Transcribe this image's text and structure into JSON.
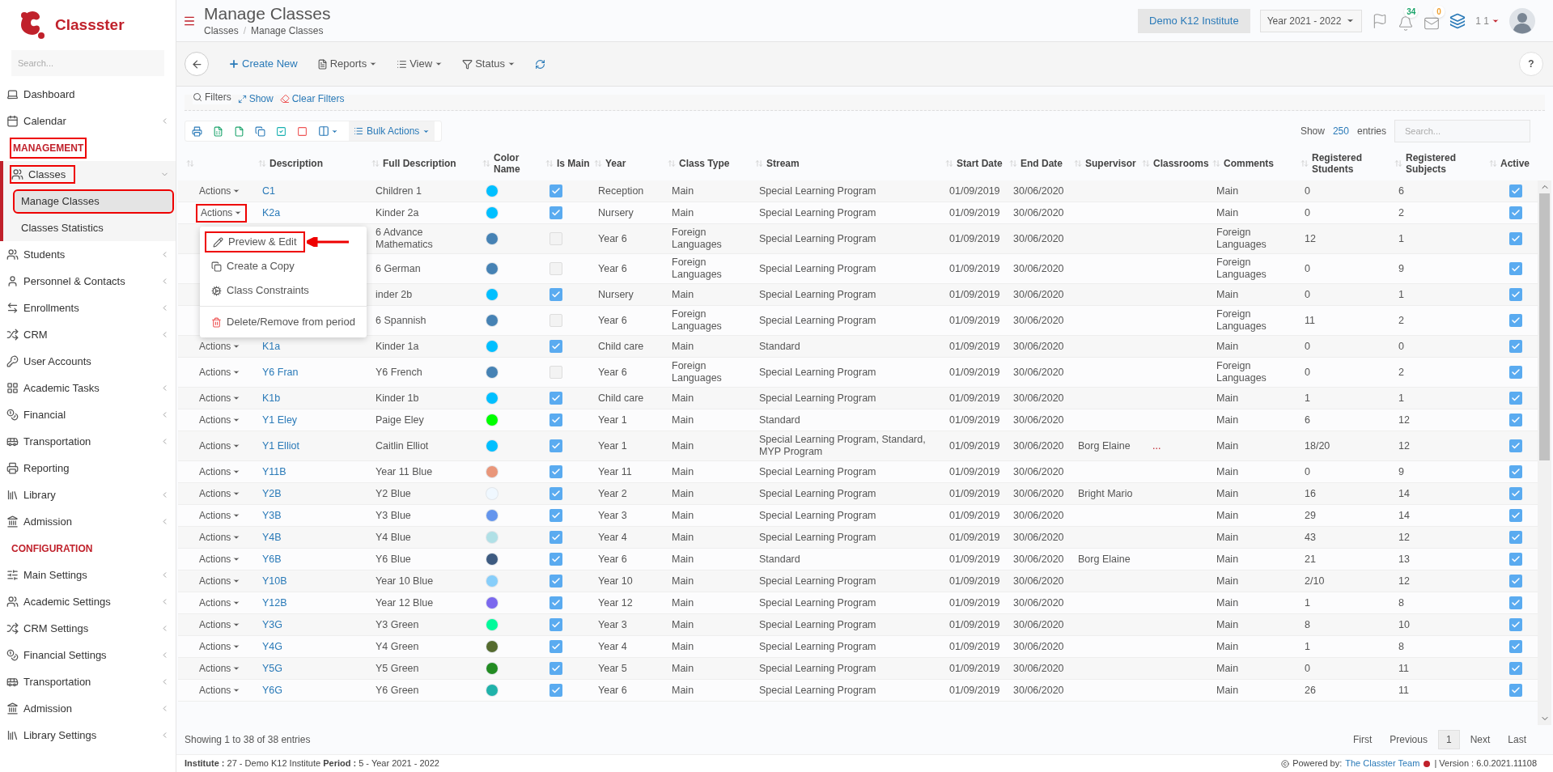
{
  "sidebar": {
    "logo": "Classster",
    "search_placeholder": "Search...",
    "items": [
      {
        "kind": "item",
        "label": "Dashboard",
        "has_submenu": false,
        "expanded": false,
        "highlighted": false
      },
      {
        "kind": "item",
        "label": "Calendar",
        "has_submenu": true,
        "expanded": false,
        "highlighted": false
      },
      {
        "kind": "section",
        "label": "MANAGEMENT",
        "highlighted": true
      },
      {
        "kind": "item",
        "label": "Classes",
        "has_submenu": true,
        "expanded": true,
        "highlighted": true,
        "children": [
          {
            "label": "Manage Classes",
            "selected": true,
            "highlighted": true
          },
          {
            "label": "Classes Statistics",
            "selected": false,
            "highlighted": false
          }
        ]
      },
      {
        "kind": "item",
        "label": "Students",
        "has_submenu": true,
        "expanded": false,
        "highlighted": false
      },
      {
        "kind": "item",
        "label": "Personnel & Contacts",
        "has_submenu": true,
        "expanded": false,
        "highlighted": false
      },
      {
        "kind": "item",
        "label": "Enrollments",
        "has_submenu": true,
        "expanded": false,
        "highlighted": false
      },
      {
        "kind": "item",
        "label": "CRM",
        "has_submenu": true,
        "expanded": false,
        "highlighted": false
      },
      {
        "kind": "item",
        "label": "User Accounts",
        "has_submenu": false,
        "expanded": false,
        "highlighted": false
      },
      {
        "kind": "item",
        "label": "Academic Tasks",
        "has_submenu": true,
        "expanded": false,
        "highlighted": false
      },
      {
        "kind": "item",
        "label": "Financial",
        "has_submenu": true,
        "expanded": false,
        "highlighted": false
      },
      {
        "kind": "item",
        "label": "Transportation",
        "has_submenu": true,
        "expanded": false,
        "highlighted": false
      },
      {
        "kind": "item",
        "label": "Reporting",
        "has_submenu": false,
        "expanded": false,
        "highlighted": false
      },
      {
        "kind": "item",
        "label": "Library",
        "has_submenu": true,
        "expanded": false,
        "highlighted": false
      },
      {
        "kind": "item",
        "label": "Admission",
        "has_submenu": true,
        "expanded": false,
        "highlighted": false
      },
      {
        "kind": "section",
        "label": "CONFIGURATION",
        "highlighted": false
      },
      {
        "kind": "item",
        "label": "Main Settings",
        "has_submenu": true,
        "expanded": false,
        "highlighted": false
      },
      {
        "kind": "item",
        "label": "Academic Settings",
        "has_submenu": true,
        "expanded": false,
        "highlighted": false
      },
      {
        "kind": "item",
        "label": "CRM Settings",
        "has_submenu": true,
        "expanded": false,
        "highlighted": false
      },
      {
        "kind": "item",
        "label": "Financial Settings",
        "has_submenu": true,
        "expanded": false,
        "highlighted": false
      },
      {
        "kind": "item",
        "label": "Transportation",
        "has_submenu": true,
        "expanded": false,
        "highlighted": false
      },
      {
        "kind": "item",
        "label": "Admission",
        "has_submenu": true,
        "expanded": false,
        "highlighted": false
      },
      {
        "kind": "item",
        "label": "Library Settings",
        "has_submenu": true,
        "expanded": false,
        "highlighted": false
      }
    ]
  },
  "header": {
    "title": "Manage Classes",
    "breadcrumb": [
      "Classes",
      "Manage Classes"
    ],
    "breadcrumb_separator": "/",
    "institute": "Demo K12 Institute",
    "year": "Year 2021 - 2022",
    "notifications": "34",
    "messages": "0",
    "user": "1 1"
  },
  "toolbar": {
    "buttons": [
      {
        "label": "Create New",
        "kind": "create"
      },
      {
        "label": "Reports",
        "kind": "reports"
      },
      {
        "label": "View",
        "kind": "view"
      },
      {
        "label": "Status",
        "kind": "status"
      }
    ],
    "help": "?"
  },
  "filters": {
    "legend": "Filters",
    "show": "Show",
    "clear": "Clear Filters"
  },
  "table_tools": {
    "bulk": "Bulk Actions",
    "show_label": "Show",
    "entries": "250",
    "entries_label": "entries",
    "search_placeholder": "Search..."
  },
  "table": {
    "columns": [
      "Description",
      "Full Description",
      "Color Name",
      "Is Main",
      "Year",
      "Class Type",
      "Stream",
      "Start Date",
      "End Date",
      "Supervisor",
      "Classrooms",
      "Comments",
      "Registered Students",
      "Registered Subjects",
      "Active"
    ],
    "rows": [
      {
        "actions": "Actions",
        "description": "C1",
        "full_description": "Children 1",
        "color": "#00bfff",
        "is_main": true,
        "year": "Reception",
        "class_type": "Main",
        "stream": "Special Learning Program",
        "start": "01/09/2019",
        "end": "30/06/2020",
        "comments": "Main",
        "students": "0",
        "subjects": "6",
        "active": true
      },
      {
        "actions": "Actions",
        "description": "K2a",
        "full_description": "Kinder 2a",
        "color": "#00bfff",
        "is_main": true,
        "year": "Nursery",
        "class_type": "Main",
        "stream": "Special Learning Program",
        "start": "01/09/2019",
        "end": "30/06/2020",
        "comments": "Main",
        "students": "0",
        "subjects": "2",
        "active": true,
        "highlighted": true,
        "menu": [
          {
            "label": "Preview & Edit",
            "kind": "edit",
            "highlighted": true
          },
          {
            "label": "Create a Copy",
            "kind": "copy",
            "highlighted": false
          },
          {
            "label": "Class Constraints",
            "kind": "constraints",
            "highlighted": false
          },
          {
            "label": "Delete/Remove from period",
            "kind": "delete",
            "highlighted": false
          }
        ]
      },
      {
        "full_description": "6 Advance Mathematics",
        "color": "#4682b4",
        "is_main": false,
        "year": "Year 6",
        "class_type": "Foreign Languages",
        "stream": "Special Learning Program",
        "start": "01/09/2019",
        "end": "30/06/2020",
        "comments": "Foreign Languages",
        "students": "12",
        "subjects": "1",
        "active": true
      },
      {
        "full_description": "6 German",
        "color": "#4682b4",
        "is_main": false,
        "year": "Year 6",
        "class_type": "Foreign Languages",
        "stream": "Special Learning Program",
        "start": "01/09/2019",
        "end": "30/06/2020",
        "comments": "Foreign Languages",
        "students": "0",
        "subjects": "9",
        "active": true
      },
      {
        "full_description": "inder 2b",
        "color": "#00bfff",
        "is_main": true,
        "year": "Nursery",
        "class_type": "Main",
        "stream": "Special Learning Program",
        "start": "01/09/2019",
        "end": "30/06/2020",
        "comments": "Main",
        "students": "0",
        "subjects": "1",
        "active": true
      },
      {
        "full_description": "6 Spannish",
        "color": "#4682b4",
        "is_main": false,
        "year": "Year 6",
        "class_type": "Foreign Languages",
        "stream": "Special Learning Program",
        "start": "01/09/2019",
        "end": "30/06/2020",
        "comments": "Foreign Languages",
        "students": "11",
        "subjects": "2",
        "active": true
      },
      {
        "actions": "Actions",
        "description": "K1a",
        "full_description": "Kinder 1a",
        "color": "#00bfff",
        "is_main": true,
        "year": "Child care",
        "class_type": "Main",
        "stream": "Standard",
        "start": "01/09/2019",
        "end": "30/06/2020",
        "comments": "Main",
        "students": "0",
        "subjects": "0",
        "active": true
      },
      {
        "actions": "Actions",
        "description": "Y6 Fran",
        "full_description": "Y6 French",
        "color": "#4682b4",
        "is_main": false,
        "year": "Year 6",
        "class_type": "Foreign Languages",
        "stream": "Special Learning Program",
        "start": "01/09/2019",
        "end": "30/06/2020",
        "comments": "Foreign Languages",
        "students": "0",
        "subjects": "2",
        "active": true
      },
      {
        "actions": "Actions",
        "description": "K1b",
        "full_description": "Kinder 1b",
        "color": "#00bfff",
        "is_main": true,
        "year": "Child care",
        "class_type": "Main",
        "stream": "Special Learning Program",
        "start": "01/09/2019",
        "end": "30/06/2020",
        "comments": "Main",
        "students": "1",
        "subjects": "1",
        "active": true
      },
      {
        "actions": "Actions",
        "description": "Y1 Eley",
        "full_description": "Paige Eley",
        "color": "#00ff00",
        "is_main": true,
        "year": "Year 1",
        "class_type": "Main",
        "stream": "Standard",
        "start": "01/09/2019",
        "end": "30/06/2020",
        "comments": "Main",
        "students": "6",
        "subjects": "12",
        "active": true
      },
      {
        "actions": "Actions",
        "description": "Y1 Elliot",
        "full_description": "Caitlin Elliot",
        "color": "#00bfff",
        "is_main": true,
        "year": "Year 1",
        "class_type": "Main",
        "stream": "Special Learning Program, Standard, MYP Program",
        "start": "01/09/2019",
        "end": "30/06/2020",
        "supervisor": "Borg Elaine",
        "classrooms": "...",
        "comments": "Main",
        "students": "18/20",
        "subjects": "12",
        "active": true
      },
      {
        "actions": "Actions",
        "description": "Y11B",
        "full_description": "Year 11 Blue",
        "color": "#e9967a",
        "is_main": true,
        "year": "Year 11",
        "class_type": "Main",
        "stream": "Special Learning Program",
        "start": "01/09/2019",
        "end": "30/06/2020",
        "comments": "Main",
        "students": "0",
        "subjects": "9",
        "active": true
      },
      {
        "actions": "Actions",
        "description": "Y2B",
        "full_description": "Y2 Blue",
        "color": "#f0f8ff",
        "is_main": true,
        "year": "Year 2",
        "class_type": "Main",
        "stream": "Special Learning Program",
        "start": "01/09/2019",
        "end": "30/06/2020",
        "supervisor": "Bright Mario",
        "comments": "Main",
        "students": "16",
        "subjects": "14",
        "active": true
      },
      {
        "actions": "Actions",
        "description": "Y3B",
        "full_description": "Y3 Blue",
        "color": "#6495ed",
        "is_main": true,
        "year": "Year 3",
        "class_type": "Main",
        "stream": "Special Learning Program",
        "start": "01/09/2019",
        "end": "30/06/2020",
        "comments": "Main",
        "students": "29",
        "subjects": "14",
        "active": true
      },
      {
        "actions": "Actions",
        "description": "Y4B",
        "full_description": "Y4 Blue",
        "color": "#b0e0e6",
        "is_main": true,
        "year": "Year 4",
        "class_type": "Main",
        "stream": "Special Learning Program",
        "start": "01/09/2019",
        "end": "30/06/2020",
        "comments": "Main",
        "students": "43",
        "subjects": "12",
        "active": true
      },
      {
        "actions": "Actions",
        "description": "Y6B",
        "full_description": "Y6 Blue",
        "color": "#3d5a80",
        "is_main": true,
        "year": "Year 6",
        "class_type": "Main",
        "stream": "Standard",
        "start": "01/09/2019",
        "end": "30/06/2020",
        "supervisor": "Borg Elaine",
        "comments": "Main",
        "students": "21",
        "subjects": "13",
        "active": true
      },
      {
        "actions": "Actions",
        "description": "Y10B",
        "full_description": "Year 10 Blue",
        "color": "#87cefa",
        "is_main": true,
        "year": "Year 10",
        "class_type": "Main",
        "stream": "Special Learning Program",
        "start": "01/09/2019",
        "end": "30/06/2020",
        "comments": "Main",
        "students": "2/10",
        "subjects": "12",
        "active": true
      },
      {
        "actions": "Actions",
        "description": "Y12B",
        "full_description": "Year 12 Blue",
        "color": "#7b68ee",
        "is_main": true,
        "year": "Year 12",
        "class_type": "Main",
        "stream": "Special Learning Program",
        "start": "01/09/2019",
        "end": "30/06/2020",
        "comments": "Main",
        "students": "1",
        "subjects": "8",
        "active": true
      },
      {
        "actions": "Actions",
        "description": "Y3G",
        "full_description": "Y3 Green",
        "color": "#00fa9a",
        "is_main": true,
        "year": "Year 3",
        "class_type": "Main",
        "stream": "Special Learning Program",
        "start": "01/09/2019",
        "end": "30/06/2020",
        "comments": "Main",
        "students": "8",
        "subjects": "10",
        "active": true
      },
      {
        "actions": "Actions",
        "description": "Y4G",
        "full_description": "Y4 Green",
        "color": "#556b2f",
        "is_main": true,
        "year": "Year 4",
        "class_type": "Main",
        "stream": "Special Learning Program",
        "start": "01/09/2019",
        "end": "30/06/2020",
        "comments": "Main",
        "students": "1",
        "subjects": "8",
        "active": true
      },
      {
        "actions": "Actions",
        "description": "Y5G",
        "full_description": "Y5 Green",
        "color": "#228b22",
        "is_main": true,
        "year": "Year 5",
        "class_type": "Main",
        "stream": "Special Learning Program",
        "start": "01/09/2019",
        "end": "30/06/2020",
        "comments": "Main",
        "students": "0",
        "subjects": "11",
        "active": true
      },
      {
        "actions": "Actions",
        "description": "Y6G",
        "full_description": "Y6 Green",
        "color": "#20b2aa",
        "is_main": true,
        "year": "Year 6",
        "class_type": "Main",
        "stream": "Special Learning Program",
        "start": "01/09/2019",
        "end": "30/06/2020",
        "comments": "Main",
        "students": "26",
        "subjects": "11",
        "active": true
      }
    ]
  },
  "footer": {
    "info": "Showing 1 to 38 of 38 entries",
    "pages": [
      {
        "label": "First",
        "selected": false
      },
      {
        "label": "Previous",
        "selected": false
      },
      {
        "label": "1",
        "selected": true
      },
      {
        "label": "Next",
        "selected": false
      },
      {
        "label": "Last",
        "selected": false
      }
    ]
  },
  "status_bar": {
    "left": "**Institute :** 27 - Demo K12 Institute **Period :** 5 - Year 2021 - 2022",
    "powered": "Powered by:",
    "team": "The Classter Team",
    "version": "| Version : 6.0.2021.11108"
  }
}
